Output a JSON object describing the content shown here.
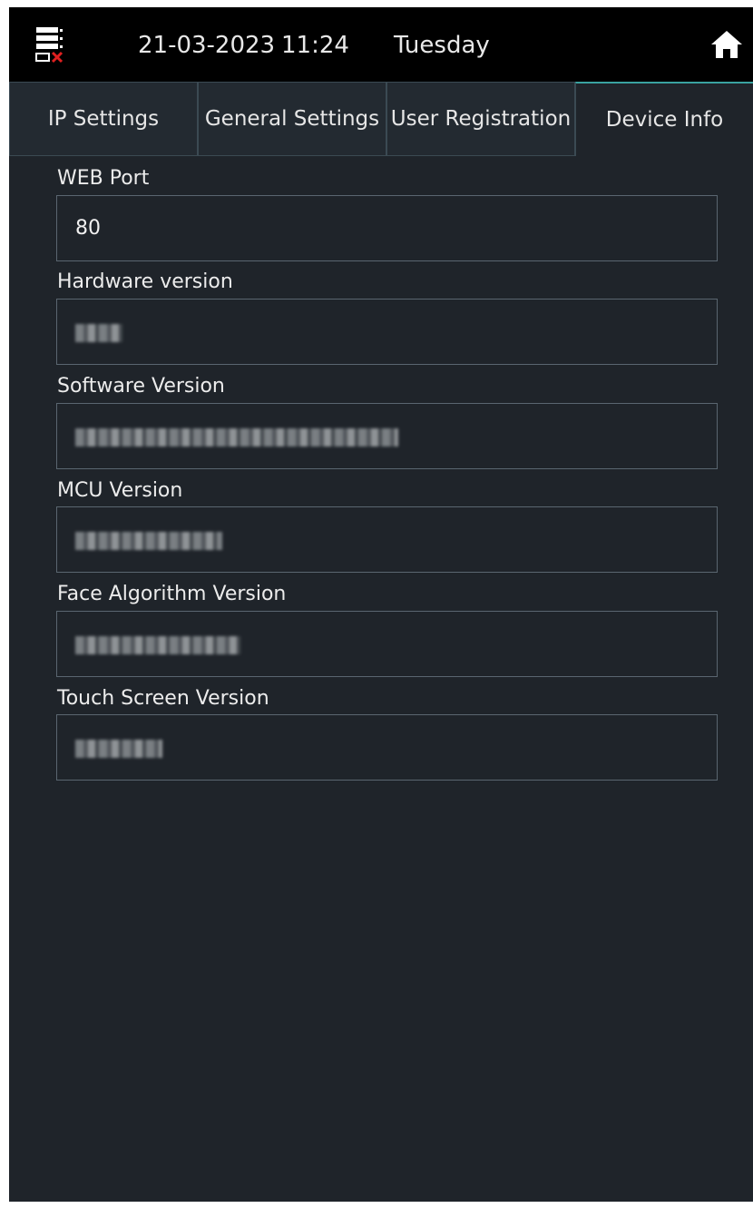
{
  "status_bar": {
    "date": "21-03-2023",
    "time": "11:24",
    "weekday": "Tuesday",
    "network_icon": "network-disconnected-icon",
    "home_icon": "home-icon"
  },
  "tabs": [
    {
      "label": "IP Settings",
      "active": false
    },
    {
      "label": "General Settings",
      "active": false
    },
    {
      "label": "User Registration",
      "active": false
    },
    {
      "label": "Device Info",
      "active": true
    }
  ],
  "fields": {
    "web_port": {
      "label": "WEB Port",
      "value": "80"
    },
    "hardware_version": {
      "label": "Hardware version",
      "value_obscured": true
    },
    "software_version": {
      "label": "Software Version",
      "value_obscured": true
    },
    "mcu_version": {
      "label": "MCU Version",
      "value_obscured": true
    },
    "face_algorithm_version": {
      "label": "Face Algorithm Version",
      "value_obscured": true
    },
    "touch_screen_version": {
      "label": "Touch Screen Version",
      "value_obscured": true
    }
  },
  "colors": {
    "background": "#1f242a",
    "status_bar": "#000000",
    "active_tab_accent": "#3aa3a0",
    "disconnect_mark": "#e02020"
  }
}
